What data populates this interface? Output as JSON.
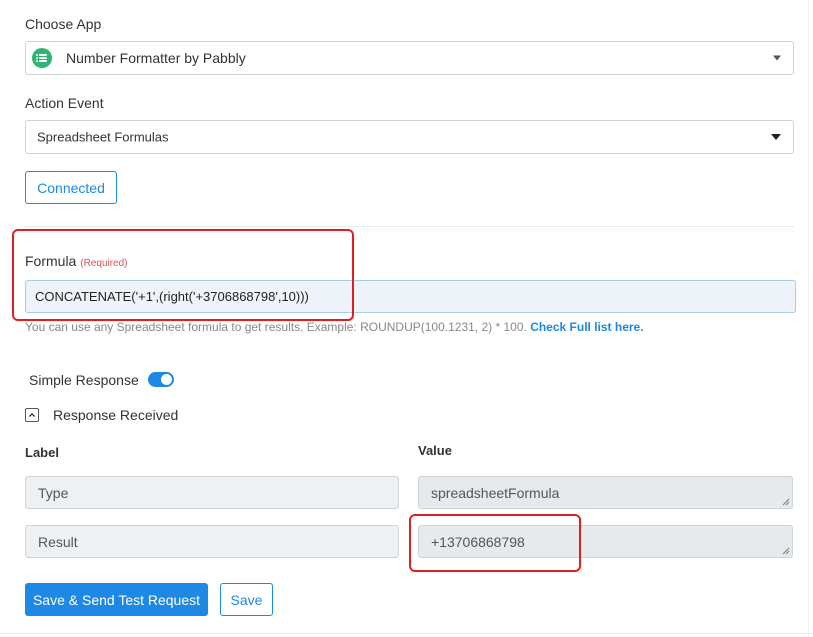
{
  "choose_app": {
    "label": "Choose App",
    "selected": "Number Formatter by Pabbly",
    "icon": "number-formatter-icon",
    "icon_color": "#2fb573"
  },
  "action_event": {
    "label": "Action Event",
    "selected": "Spreadsheet Formulas"
  },
  "connected_button": "Connected",
  "formula": {
    "label": "Formula",
    "required_tag": "(Required)",
    "value": "CONCATENATE('+1',(right('+3706868798',10)))",
    "help_text": "You can use any Spreadsheet formula to get results. Example: ROUNDUP(100.1231, 2) * 100.",
    "help_link": "Check Full list here."
  },
  "simple_response": {
    "label": "Simple Response",
    "enabled": true
  },
  "response_received": {
    "label": "Response Received",
    "columns": {
      "label": "Label",
      "value": "Value"
    },
    "rows": [
      {
        "label": "Type",
        "value": "spreadsheetFormula"
      },
      {
        "label": "Result",
        "value": "+13706868798"
      }
    ]
  },
  "buttons": {
    "save_send": "Save & Send Test Request",
    "save": "Save"
  },
  "colors": {
    "accent": "#1e88e5",
    "annotation": "#e02020"
  }
}
